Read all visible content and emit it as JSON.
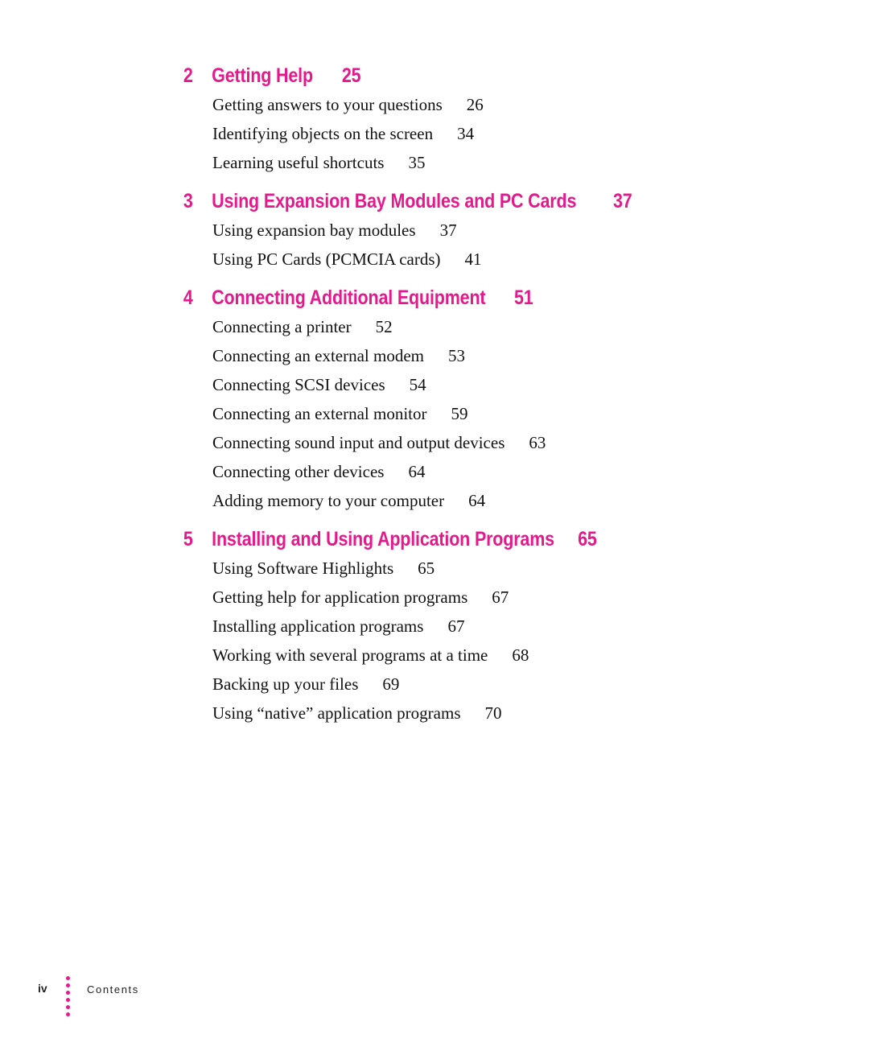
{
  "accent_color": "#e6198c",
  "chapters": [
    {
      "number": "2",
      "title": "Getting Help",
      "page": "25",
      "entries": [
        {
          "title": "Getting answers to your questions",
          "page": "26"
        },
        {
          "title": "Identifying objects on the screen",
          "page": "34"
        },
        {
          "title": "Learning useful shortcuts",
          "page": "35"
        }
      ]
    },
    {
      "number": "3",
      "title": "Using Expansion Bay Modules and PC Cards",
      "page": "37",
      "entries": [
        {
          "title": "Using expansion bay modules",
          "page": "37"
        },
        {
          "title": "Using PC Cards (PCMCIA cards)",
          "page": "41"
        }
      ]
    },
    {
      "number": "4",
      "title": "Connecting Additional Equipment",
      "page": "51",
      "entries": [
        {
          "title": "Connecting a printer",
          "page": "52"
        },
        {
          "title": "Connecting an external modem",
          "page": "53"
        },
        {
          "title": "Connecting SCSI devices",
          "page": "54"
        },
        {
          "title": "Connecting an external monitor",
          "page": "59"
        },
        {
          "title": "Connecting sound input and output devices",
          "page": "63"
        },
        {
          "title": "Connecting other devices",
          "page": "64"
        },
        {
          "title": "Adding memory to your computer",
          "page": "64"
        }
      ]
    },
    {
      "number": "5",
      "title": "Installing and Using Application Programs",
      "page": "65",
      "entries": [
        {
          "title": "Using Software Highlights",
          "page": "65"
        },
        {
          "title": "Getting help for application programs",
          "page": "67"
        },
        {
          "title": "Installing application programs",
          "page": "67"
        },
        {
          "title": "Working with several programs at a time",
          "page": "68"
        },
        {
          "title": "Backing up your files",
          "page": "69"
        },
        {
          "title": "Using “native” application programs",
          "page": "70"
        }
      ]
    }
  ],
  "footer": {
    "folio": "iv",
    "label": "Contents"
  }
}
